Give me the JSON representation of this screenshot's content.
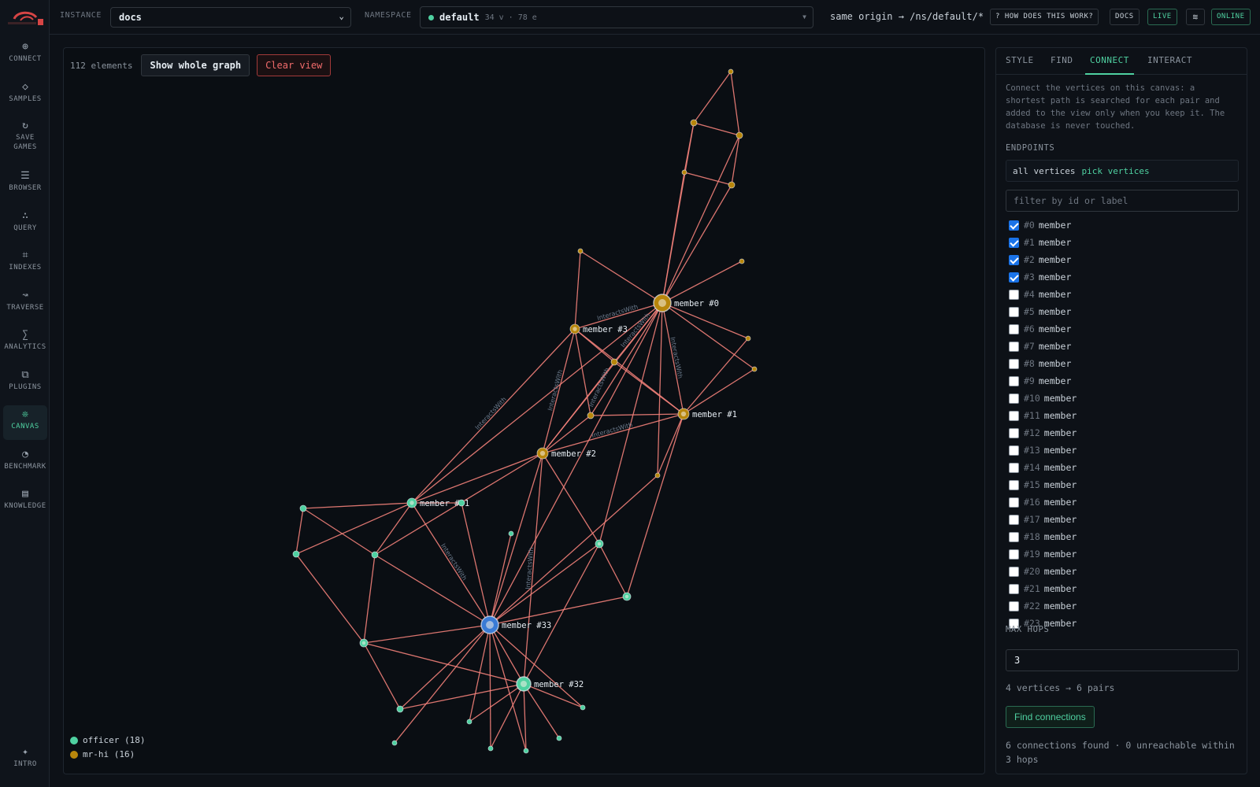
{
  "rail": {
    "items": [
      {
        "label": "Connect",
        "icon": "⊕"
      },
      {
        "label": "Samples",
        "icon": "◇"
      },
      {
        "label": "Save games",
        "icon": "↻"
      },
      {
        "label": "Browser",
        "icon": "☰"
      },
      {
        "label": "Query",
        "icon": "∴"
      },
      {
        "label": "Indexes",
        "icon": "⌗"
      },
      {
        "label": "Traverse",
        "icon": "↝"
      },
      {
        "label": "Analytics",
        "icon": "∑"
      },
      {
        "label": "Plugins",
        "icon": "⧉"
      },
      {
        "label": "Canvas",
        "icon": "❊"
      },
      {
        "label": "Benchmark",
        "icon": "◔"
      },
      {
        "label": "Knowledge",
        "icon": "▤"
      }
    ],
    "intro": {
      "label": "Intro",
      "icon": "✦"
    }
  },
  "topbar": {
    "instance_label": "Instance",
    "instance_value": "docs",
    "namespace_label": "Namespace",
    "namespace_value": "default",
    "namespace_stats": "34 v · 78 e",
    "origin": "same origin → /ns/default/*",
    "help_button": "? How does this work?",
    "docs_button": "Docs",
    "live_button": "Live",
    "online_badge": "Online"
  },
  "canvas": {
    "element_count": "112 elements",
    "show_whole_graph": "Show whole graph",
    "clear_view": "Clear view",
    "edge_label": "InteractsWith",
    "legend": [
      {
        "label": "officer (18)",
        "color": "#4fd1a1"
      },
      {
        "label": "mr-hi (16)",
        "color": "#b8860b"
      }
    ],
    "node_labels": {
      "m0": "member #0",
      "m1": "member #1",
      "m2": "member #2",
      "m3": "member #3",
      "m31": "member #31",
      "m32": "member #32",
      "m33": "member #33"
    }
  },
  "panel": {
    "tabs": [
      {
        "label": "Style",
        "active": false
      },
      {
        "label": "Find",
        "active": false
      },
      {
        "label": "Connect",
        "active": true
      },
      {
        "label": "Interact",
        "active": false
      }
    ],
    "description": "Connect the vertices on this canvas: a shortest path is searched for each pair and added to the view only when you keep it. The database is never touched.",
    "endpoints_label": "Endpoints",
    "endpoint_options": [
      {
        "label": "all vertices",
        "active": false
      },
      {
        "label": "pick vertices",
        "active": true
      }
    ],
    "filter_placeholder": "filter by id or label",
    "vertices": [
      {
        "id": "#0",
        "label": "member",
        "checked": true
      },
      {
        "id": "#1",
        "label": "member",
        "checked": true
      },
      {
        "id": "#2",
        "label": "member",
        "checked": true
      },
      {
        "id": "#3",
        "label": "member",
        "checked": true
      },
      {
        "id": "#4",
        "label": "member",
        "checked": false
      },
      {
        "id": "#5",
        "label": "member",
        "checked": false
      },
      {
        "id": "#6",
        "label": "member",
        "checked": false
      },
      {
        "id": "#7",
        "label": "member",
        "checked": false
      },
      {
        "id": "#8",
        "label": "member",
        "checked": false
      },
      {
        "id": "#9",
        "label": "member",
        "checked": false
      },
      {
        "id": "#10",
        "label": "member",
        "checked": false
      },
      {
        "id": "#11",
        "label": "member",
        "checked": false
      },
      {
        "id": "#12",
        "label": "member",
        "checked": false
      },
      {
        "id": "#13",
        "label": "member",
        "checked": false
      },
      {
        "id": "#14",
        "label": "member",
        "checked": false
      },
      {
        "id": "#15",
        "label": "member",
        "checked": false
      },
      {
        "id": "#16",
        "label": "member",
        "checked": false
      },
      {
        "id": "#17",
        "label": "member",
        "checked": false
      },
      {
        "id": "#18",
        "label": "member",
        "checked": false
      },
      {
        "id": "#19",
        "label": "member",
        "checked": false
      },
      {
        "id": "#20",
        "label": "member",
        "checked": false
      },
      {
        "id": "#21",
        "label": "member",
        "checked": false
      },
      {
        "id": "#22",
        "label": "member",
        "checked": false
      },
      {
        "id": "#23",
        "label": "member",
        "checked": false
      }
    ],
    "max_hops_label": "Max hops",
    "max_hops_value": "3",
    "pairs_text": "4 vertices → 6 pairs",
    "find_button": "Find connections",
    "result_text": "6 connections found · 0 unreachable within 3 hops"
  }
}
